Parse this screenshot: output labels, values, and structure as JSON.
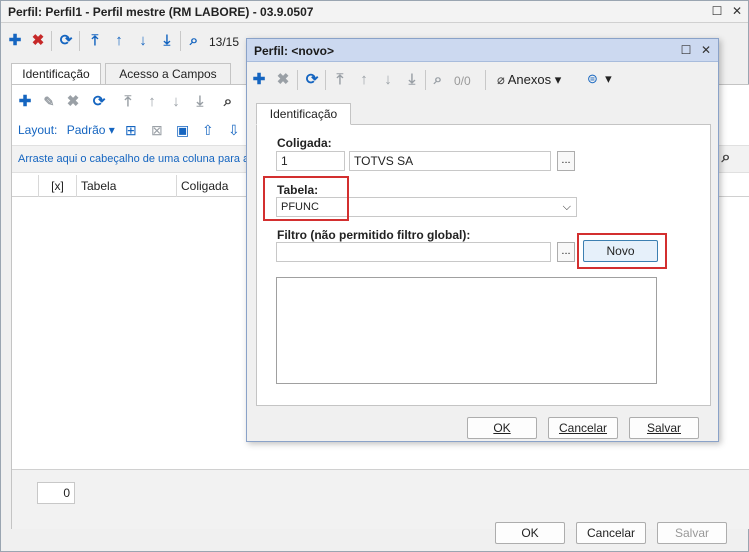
{
  "main": {
    "title": "Perfil: Perfil1 - Perfil mestre (RM LABORE) - 03.9.0507",
    "record_counter": "13/15",
    "tabs": [
      {
        "label": "Identificação"
      },
      {
        "label": "Acesso a Campos"
      }
    ],
    "layout_label": "Layout:",
    "layout_value": "Padrão",
    "group_hint": "Arraste aqui o cabeçalho de uma coluna para ag",
    "columns": [
      "[x]",
      "Tabela",
      "Coligada"
    ],
    "footer_count": "0",
    "buttons": {
      "ok": "OK",
      "cancel": "Cancelar",
      "save": "Salvar"
    }
  },
  "dialog": {
    "title": "Perfil: <novo>",
    "record_counter": "0/0",
    "attachments_label": "Anexos",
    "tab": "Identificação",
    "coligada_label": "Coligada:",
    "coligada_code": "1",
    "coligada_name": "TOTVS SA",
    "tabela_label": "Tabela:",
    "tabela_value": "PFUNC",
    "filtro_label": "Filtro (não permitido filtro global):",
    "filtro_value": "",
    "novo_button": "Novo",
    "browse_button": "...",
    "buttons": {
      "ok": "OK",
      "cancel": "Cancelar",
      "save": "Salvar"
    }
  },
  "colors": {
    "accent": "#1565c0",
    "highlight": "#d32f2f",
    "dialog_title": "#ccd9f0"
  }
}
